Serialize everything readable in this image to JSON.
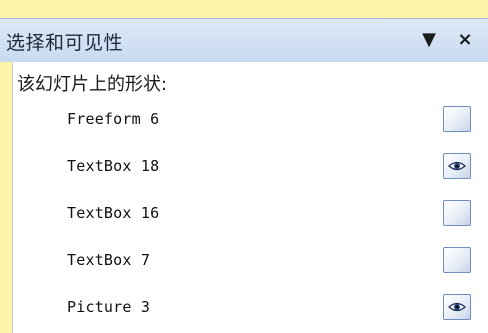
{
  "pane": {
    "title": "选择和可见性",
    "dropdown_glyph": "▼",
    "close_glyph": "×",
    "subtitle": "该幻灯片上的形状:"
  },
  "shapes": [
    {
      "name": "Freeform 6",
      "visible_icon": "empty"
    },
    {
      "name": "TextBox 18",
      "visible_icon": "eye"
    },
    {
      "name": "TextBox 16",
      "visible_icon": "empty"
    },
    {
      "name": "TextBox 7",
      "visible_icon": "empty"
    },
    {
      "name": "Picture 3",
      "visible_icon": "eye"
    }
  ],
  "colors": {
    "background": "#FFF5A8",
    "header": "#C9DAF0",
    "button_border": "#6E8FBF"
  }
}
